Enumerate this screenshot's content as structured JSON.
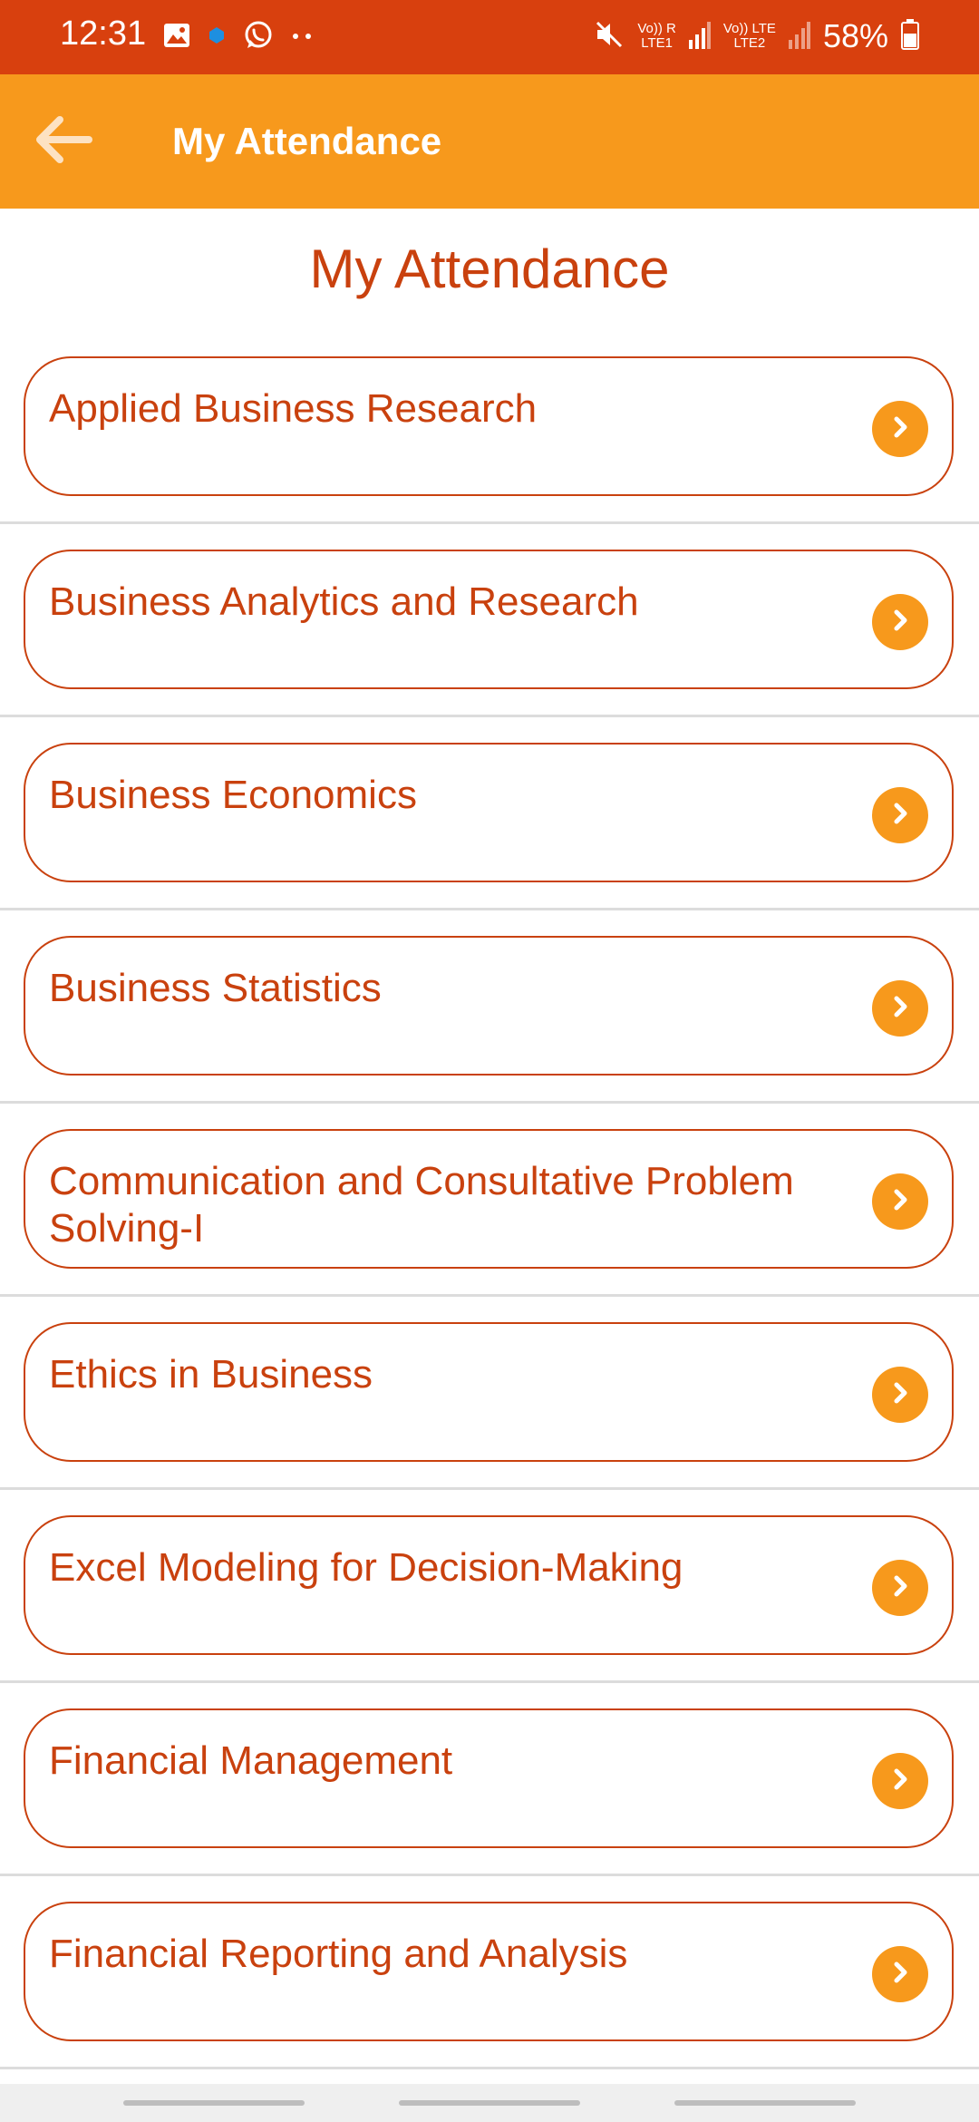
{
  "status_bar": {
    "time": "12:31",
    "left_icons": [
      "gallery-icon",
      "notification-dot-icon",
      "whatsapp-icon",
      "more-dots-icon"
    ],
    "network1_top": "Vo)) R",
    "network1_bottom": "LTE1",
    "network2_top": "Vo)) LTE",
    "network2_bottom": "LTE2",
    "battery": "58%",
    "colors": {
      "background": "#D8400E"
    }
  },
  "app_bar": {
    "title": "My Attendance",
    "back_icon": "arrow-left-icon",
    "colors": {
      "background": "#F7991C"
    }
  },
  "page": {
    "heading": "My Attendance"
  },
  "courses": [
    {
      "name": "Applied Business Research"
    },
    {
      "name": "Business Analytics and Research"
    },
    {
      "name": "Business Economics"
    },
    {
      "name": "Business Statistics"
    },
    {
      "name": "Communication and Consultative Problem Solving-I"
    },
    {
      "name": "Ethics in Business"
    },
    {
      "name": "Excel Modeling for Decision-Making"
    },
    {
      "name": "Financial Management"
    },
    {
      "name": "Financial Reporting and Analysis"
    }
  ],
  "theme": {
    "accent": "#C9410E",
    "chevron": "#F7991C",
    "divider": "#DCDCDC"
  }
}
